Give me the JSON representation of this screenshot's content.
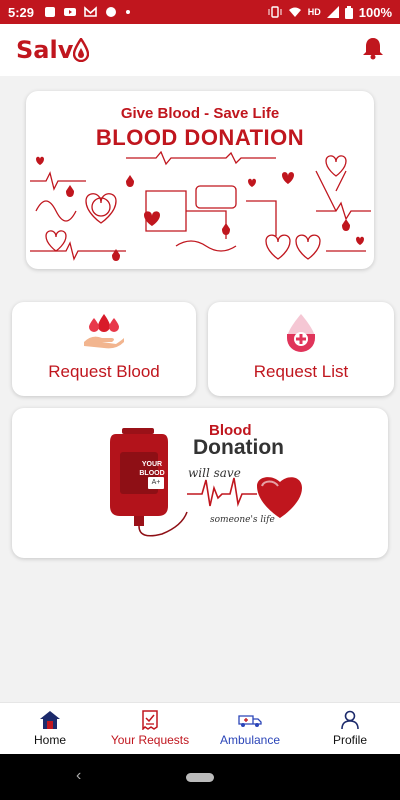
{
  "status_bar": {
    "time": "5:29",
    "network": "HD",
    "battery": "100%"
  },
  "app_bar": {
    "logo_text": "Salv",
    "bell_icon": "bell-icon"
  },
  "banner": {
    "tagline": "Give Blood - Save Life",
    "title": "BLOOD DONATION"
  },
  "cards": {
    "request_blood": {
      "label": "Request Blood",
      "icon": "blood-drop-hand-icon"
    },
    "request_list": {
      "label": "Request List",
      "icon": "blood-drop-plus-icon"
    }
  },
  "donation_card": {
    "blood_word": "Blood",
    "donation_word": "Donation",
    "will_save": "will save",
    "someones_life": "someone's life",
    "bag_text": "YOUR BLOOD",
    "bag_type": "A+"
  },
  "bottom_nav": {
    "items": [
      {
        "label": "Home",
        "icon": "home-icon"
      },
      {
        "label": "Your Requests",
        "icon": "request-doc-icon"
      },
      {
        "label": "Ambulance",
        "icon": "ambulance-icon"
      },
      {
        "label": "Profile",
        "icon": "profile-icon"
      }
    ]
  },
  "colors": {
    "brand": "#c0161e",
    "accent_blue": "#2b45b8"
  }
}
